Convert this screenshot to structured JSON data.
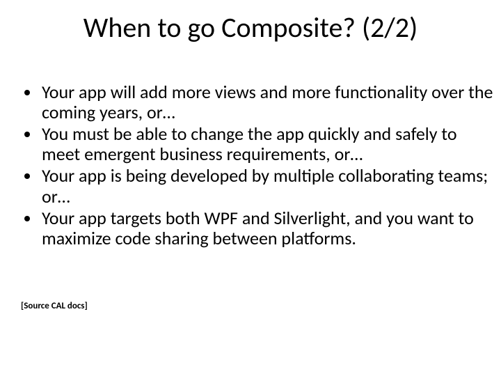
{
  "title": "When to go Composite? (2/2)",
  "bullets": [
    "Your app will add more views and more functionality over the coming years, or…",
    "You must be able to change the app quickly and safely to meet emergent business requirements, or…",
    "Your app is being developed by multiple collaborating teams; or…",
    "Your app targets both WPF and Silverlight, and you want to maximize code sharing between platforms."
  ],
  "source": "[Source CAL docs]"
}
